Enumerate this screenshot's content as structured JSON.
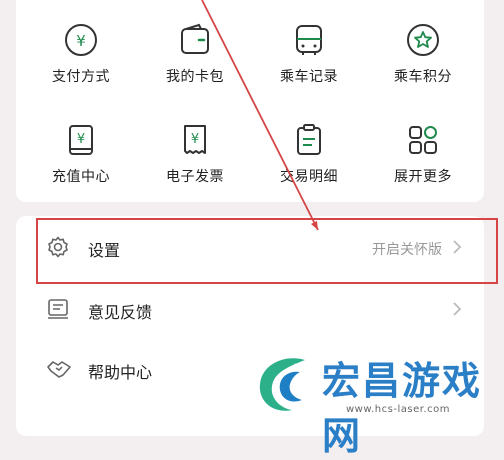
{
  "grid": {
    "items": [
      {
        "label": "支付方式",
        "icon": "yuan-circle-icon"
      },
      {
        "label": "我的卡包",
        "icon": "wallet-icon"
      },
      {
        "label": "乘车记录",
        "icon": "bus-icon"
      },
      {
        "label": "乘车积分",
        "icon": "star-badge-icon"
      },
      {
        "label": "充值中心",
        "icon": "recharge-book-icon"
      },
      {
        "label": "电子发票",
        "icon": "invoice-icon"
      },
      {
        "label": "交易明细",
        "icon": "clipboard-icon"
      },
      {
        "label": "展开更多",
        "icon": "grid-more-icon"
      }
    ]
  },
  "menu": {
    "settings": {
      "label": "设置",
      "sub": "开启关怀版",
      "icon": "gear-icon"
    },
    "feedback": {
      "label": "意见反馈",
      "icon": "feedback-icon"
    },
    "help": {
      "label": "帮助中心",
      "icon": "handshake-icon"
    }
  },
  "watermark": {
    "title": "宏昌游戏网",
    "url": "www.hcs-laser.com"
  },
  "colors": {
    "accent_green": "#1f8a4c",
    "annotation_red": "#d64545",
    "watermark_blue": "#2b7fc7"
  }
}
